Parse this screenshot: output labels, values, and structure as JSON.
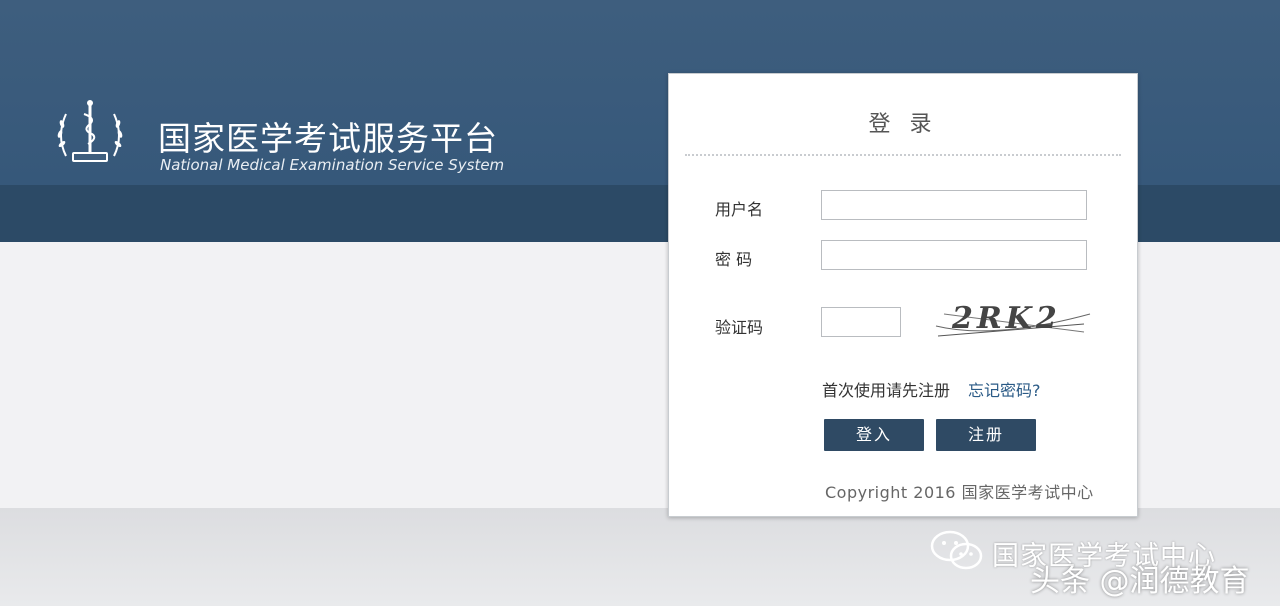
{
  "header": {
    "title": "国家医学考试服务平台",
    "subtitle": "National Medical Examination Service System"
  },
  "login": {
    "title": "登 录",
    "username_label": "用户名",
    "password_label": "密 码",
    "captcha_label": "验证码",
    "captcha_text": "2RK2",
    "register_first_link": "首次使用请先注册",
    "forgot_password_link": "忘记密码?",
    "login_button": "登入",
    "register_button": "注册",
    "copyright": "Copyright 2016 国家医学考试中心"
  },
  "watermark": {
    "line1": "国家医学考试中心",
    "line2": "头条 @润德教育"
  },
  "colors": {
    "header_top": "#3e5e7e",
    "header_band": "#2c4a66",
    "button": "#2f4a64",
    "forgot_link": "#2a5a86"
  }
}
